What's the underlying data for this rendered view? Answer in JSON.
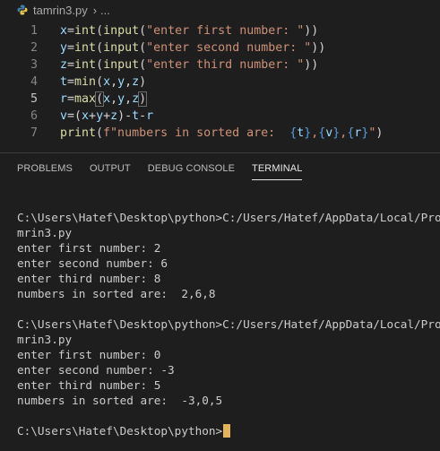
{
  "breadcrumb": {
    "file": "tamrin3.py",
    "separator": ">",
    "more": "..."
  },
  "editor": {
    "lines": [
      {
        "num": "1",
        "tokens": [
          [
            "x",
            "ident"
          ],
          [
            "=",
            "op"
          ],
          [
            "int",
            "fn"
          ],
          [
            "(",
            "op"
          ],
          [
            "input",
            "fn"
          ],
          [
            "(",
            "op"
          ],
          [
            "\"enter first number: \"",
            "str"
          ],
          [
            "))",
            "op"
          ]
        ]
      },
      {
        "num": "2",
        "tokens": [
          [
            "y",
            "ident"
          ],
          [
            "=",
            "op"
          ],
          [
            "int",
            "fn"
          ],
          [
            "(",
            "op"
          ],
          [
            "input",
            "fn"
          ],
          [
            "(",
            "op"
          ],
          [
            "\"enter second number: \"",
            "str"
          ],
          [
            "))",
            "op"
          ]
        ]
      },
      {
        "num": "3",
        "tokens": [
          [
            "z",
            "ident"
          ],
          [
            "=",
            "op"
          ],
          [
            "int",
            "fn"
          ],
          [
            "(",
            "op"
          ],
          [
            "input",
            "fn"
          ],
          [
            "(",
            "op"
          ],
          [
            "\"enter third number: \"",
            "str"
          ],
          [
            "))",
            "op"
          ]
        ]
      },
      {
        "num": "4",
        "tokens": [
          [
            "t",
            "ident"
          ],
          [
            "=",
            "op"
          ],
          [
            "min",
            "fn"
          ],
          [
            "(",
            "op"
          ],
          [
            "x",
            "ident"
          ],
          [
            ",",
            "op"
          ],
          [
            "y",
            "ident"
          ],
          [
            ",",
            "op"
          ],
          [
            "z",
            "ident"
          ],
          [
            ")",
            "op"
          ]
        ]
      },
      {
        "num": "5",
        "tokens": [
          [
            "r",
            "ident"
          ],
          [
            "=",
            "op"
          ],
          [
            "max",
            "fn"
          ],
          [
            "(",
            "hl"
          ],
          [
            "x",
            "ident"
          ],
          [
            ",",
            "op"
          ],
          [
            "y",
            "ident"
          ],
          [
            ",",
            "op"
          ],
          [
            "z",
            "ident"
          ],
          [
            ")",
            "hl"
          ]
        ]
      },
      {
        "num": "6",
        "tokens": [
          [
            "v",
            "ident"
          ],
          [
            "=(",
            "op"
          ],
          [
            "x",
            "ident"
          ],
          [
            "+",
            "op"
          ],
          [
            "y",
            "ident"
          ],
          [
            "+",
            "op"
          ],
          [
            "z",
            "ident"
          ],
          [
            ")-",
            "op"
          ],
          [
            "t",
            "ident"
          ],
          [
            "-",
            "op"
          ],
          [
            "r",
            "ident"
          ]
        ]
      },
      {
        "num": "7",
        "tokens": [
          [
            "print",
            "fn"
          ],
          [
            "(",
            "op"
          ],
          [
            "f\"numbers in sorted are:  ",
            "str"
          ],
          [
            "{",
            "brace"
          ],
          [
            "t",
            "ident"
          ],
          [
            "}",
            "brace"
          ],
          [
            ",",
            "str"
          ],
          [
            "{",
            "brace"
          ],
          [
            "v",
            "ident"
          ],
          [
            "}",
            "brace"
          ],
          [
            ",",
            "str"
          ],
          [
            "{",
            "brace"
          ],
          [
            "r",
            "ident"
          ],
          [
            "}",
            "brace"
          ],
          [
            "\"",
            "str"
          ],
          [
            ")",
            "op"
          ]
        ]
      }
    ]
  },
  "panel": {
    "tabs": [
      "PROBLEMS",
      "OUTPUT",
      "DEBUG CONSOLE",
      "TERMINAL"
    ],
    "active_tab": "TERMINAL"
  },
  "terminal": {
    "lines": [
      "C:\\Users\\Hatef\\Desktop\\python>C:/Users/Hatef/AppData/Local/Programs/",
      "mrin3.py",
      "enter first number: 2",
      "enter second number: 6",
      "enter third number: 8",
      "numbers in sorted are:  2,6,8",
      "",
      "C:\\Users\\Hatef\\Desktop\\python>C:/Users/Hatef/AppData/Local/Programs/",
      "mrin3.py",
      "enter first number: 0",
      "enter second number: -3",
      "enter third number: 5",
      "numbers in sorted are:  -3,0,5",
      "",
      "C:\\Users\\Hatef\\Desktop\\python>"
    ]
  },
  "colors": {
    "background": "#1e1e1e",
    "identifier": "#9cdcfe",
    "function": "#dcdcaa",
    "string": "#ce9178",
    "brace": "#569cd6",
    "cursor": "#e5b25c"
  },
  "icons": {
    "file_icon": "python-file-icon",
    "chevron": "chevron-right-icon"
  }
}
